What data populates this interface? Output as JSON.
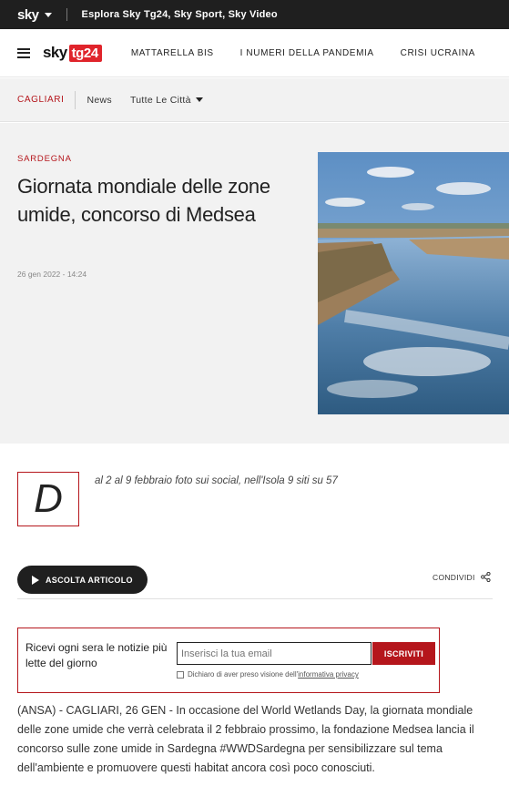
{
  "topbar": {
    "logo": "sky",
    "explore": "Esplora Sky Tg24, Sky Sport, Sky Video"
  },
  "nav": {
    "brand_sky": "sky",
    "brand_tg": "tg24",
    "links": [
      "MATTARELLA BIS",
      "I NUMERI DELLA PANDEMIA",
      "CRISI UCRAINA"
    ]
  },
  "local": {
    "city": "CAGLIARI",
    "news": "News",
    "all_cities": "Tutte Le Città"
  },
  "article": {
    "kicker": "SARDEGNA",
    "title": "Giornata mondiale delle zone umide, concorso di Medsea",
    "date": "26 gen 2022 - 14:24",
    "dropcap": "D",
    "subtitle": "al 2 al 9 febbraio foto sui social, nell'Isola 9 siti su 57",
    "listen": "ASCOLTA ARTICOLO",
    "share": "CONDIVIDI",
    "body": "(ANSA) - CAGLIARI, 26 GEN - In occasione del World Wetlands Day, la giornata mondiale delle zone umide che verrà celebrata il 2 febbraio prossimo, la fondazione Medsea lancia il concorso sulle zone umide in Sardegna #WWDSardegna per sensibilizzare sul tema dell'ambiente e promuovere questi habitat ancora così poco conosciuti."
  },
  "newsletter": {
    "text": "Ricevi ogni sera le notizie più lette del giorno",
    "placeholder": "Inserisci la tua email",
    "button": "ISCRIVITI",
    "consent_prefix": "Dichiaro di aver preso visione dell'",
    "consent_link": "informativa privacy"
  },
  "colors": {
    "accent": "#b5161c",
    "brand_red": "#e0242b",
    "dark": "#1f1f1f"
  }
}
